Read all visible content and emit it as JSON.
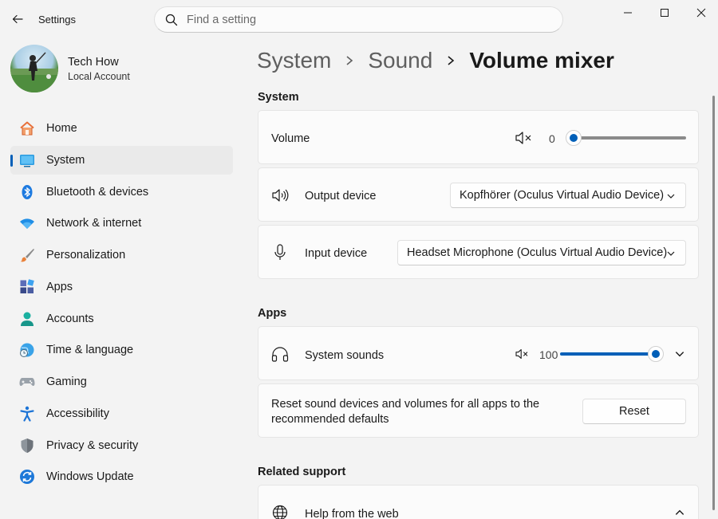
{
  "app": {
    "title": "Settings"
  },
  "search": {
    "placeholder": "Find a setting"
  },
  "profile": {
    "name": "Tech How",
    "account_type": "Local Account"
  },
  "nav": {
    "items": [
      {
        "label": "Home",
        "icon": "home-icon"
      },
      {
        "label": "System",
        "icon": "system-icon",
        "active": true
      },
      {
        "label": "Bluetooth & devices",
        "icon": "bluetooth-icon"
      },
      {
        "label": "Network & internet",
        "icon": "wifi-icon"
      },
      {
        "label": "Personalization",
        "icon": "brush-icon"
      },
      {
        "label": "Apps",
        "icon": "apps-icon"
      },
      {
        "label": "Accounts",
        "icon": "accounts-icon"
      },
      {
        "label": "Time & language",
        "icon": "globe-clock-icon"
      },
      {
        "label": "Gaming",
        "icon": "gamepad-icon"
      },
      {
        "label": "Accessibility",
        "icon": "accessibility-icon"
      },
      {
        "label": "Privacy & security",
        "icon": "shield-icon"
      },
      {
        "label": "Windows Update",
        "icon": "update-icon"
      }
    ]
  },
  "breadcrumb": {
    "items": [
      "System",
      "Sound",
      "Volume mixer"
    ]
  },
  "system_section": {
    "title": "System",
    "volume": {
      "label": "Volume",
      "value": "0",
      "level": 0
    },
    "output": {
      "label": "Output device",
      "selected": "Kopfhörer (Oculus Virtual Audio Device)"
    },
    "input": {
      "label": "Input device",
      "selected": "Headset Microphone (Oculus Virtual Audio Device)"
    }
  },
  "apps_section": {
    "title": "Apps",
    "system_sounds": {
      "label": "System sounds",
      "value": "100",
      "level": 100
    },
    "reset": {
      "text": "Reset sound devices and volumes for all apps to the recommended defaults",
      "button": "Reset"
    }
  },
  "related": {
    "title": "Related support",
    "help_label": "Help from the web"
  },
  "colors": {
    "accent": "#005fb8",
    "background": "#f3f3f3",
    "card": "#fbfbfb"
  }
}
